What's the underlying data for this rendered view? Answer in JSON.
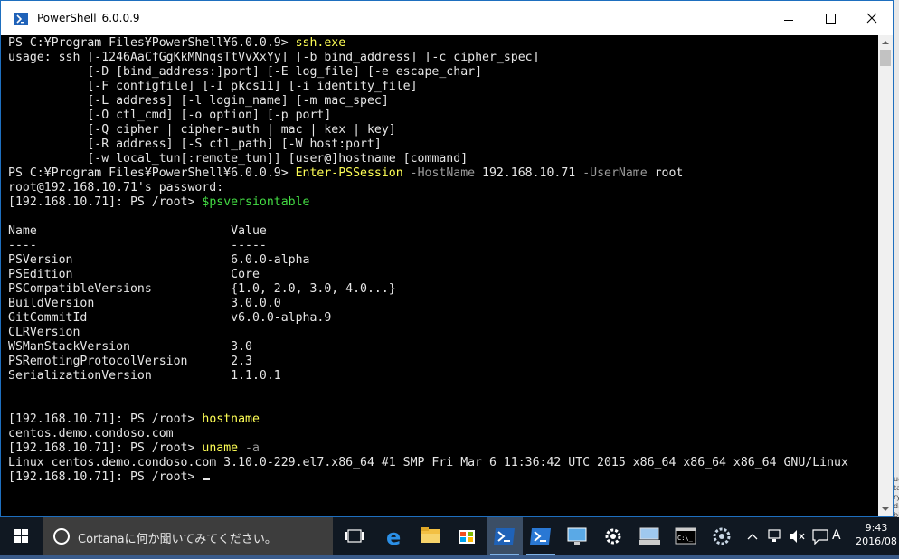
{
  "window": {
    "title": "PowerShell_6.0.0.9"
  },
  "console": {
    "lines": [
      [
        {
          "t": "PS C:¥Program Files¥PowerShell¥6.0.0.9> "
        },
        {
          "t": "ssh.exe",
          "c": "cmd"
        }
      ],
      [
        {
          "t": "usage: ssh [-1246AaCfGgKkMNnqsTtVvXxYy] [-b bind_address] [-c cipher_spec]"
        }
      ],
      [
        {
          "t": "           [-D [bind_address:]port] [-E log_file] [-e escape_char]"
        }
      ],
      [
        {
          "t": "           [-F configfile] [-I pkcs11] [-i identity_file]"
        }
      ],
      [
        {
          "t": "           [-L address] [-l login_name] [-m mac_spec]"
        }
      ],
      [
        {
          "t": "           [-O ctl_cmd] [-o option] [-p port]"
        }
      ],
      [
        {
          "t": "           [-Q cipher | cipher-auth | mac | kex | key]"
        }
      ],
      [
        {
          "t": "           [-R address] [-S ctl_path] [-W host:port]"
        }
      ],
      [
        {
          "t": "           [-w local_tun[:remote_tun]] [user@]hostname [command]"
        }
      ],
      [
        {
          "t": "PS C:¥Program Files¥PowerShell¥6.0.0.9> "
        },
        {
          "t": "Enter-PSSession",
          "c": "cmd"
        },
        {
          "t": " -HostName",
          "c": "param"
        },
        {
          "t": " 192.168.10.71"
        },
        {
          "t": " -UserName",
          "c": "param"
        },
        {
          "t": " root"
        }
      ],
      [
        {
          "t": "root@192.168.10.71's password:"
        }
      ],
      [
        {
          "t": "[192.168.10.71]: PS /root> "
        },
        {
          "t": "$psversiontable",
          "c": "var"
        }
      ],
      [
        {
          "t": ""
        }
      ],
      [
        {
          "t": "Name                           Value"
        }
      ],
      [
        {
          "t": "----                           -----"
        }
      ],
      [
        {
          "t": "PSVersion                      6.0.0-alpha"
        }
      ],
      [
        {
          "t": "PSEdition                      Core"
        }
      ],
      [
        {
          "t": "PSCompatibleVersions           {1.0, 2.0, 3.0, 4.0...}"
        }
      ],
      [
        {
          "t": "BuildVersion                   3.0.0.0"
        }
      ],
      [
        {
          "t": "GitCommitId                    v6.0.0-alpha.9"
        }
      ],
      [
        {
          "t": "CLRVersion"
        }
      ],
      [
        {
          "t": "WSManStackVersion              3.0"
        }
      ],
      [
        {
          "t": "PSRemotingProtocolVersion      2.3"
        }
      ],
      [
        {
          "t": "SerializationVersion           1.1.0.1"
        }
      ],
      [
        {
          "t": ""
        }
      ],
      [
        {
          "t": ""
        }
      ],
      [
        {
          "t": "[192.168.10.71]: PS /root> "
        },
        {
          "t": "hostname",
          "c": "cmd"
        }
      ],
      [
        {
          "t": "centos.demo.condoso.com"
        }
      ],
      [
        {
          "t": "[192.168.10.71]: PS /root> "
        },
        {
          "t": "uname",
          "c": "cmd"
        },
        {
          "t": " -a",
          "c": "param"
        }
      ],
      [
        {
          "t": "Linux centos.demo.condoso.com 3.10.0-229.el7.x86_64 #1 SMP Fri Mar 6 11:36:42 UTC 2015 x86_64 x86_64 x86_64 GNU/Linux"
        }
      ],
      [
        {
          "t": "[192.168.10.71]: PS /root> "
        },
        {
          "t": "",
          "c": "cursor"
        }
      ]
    ]
  },
  "taskbar": {
    "search_text": "Cortanaに何か聞いてみてください。",
    "ime": "A",
    "time": "9:43",
    "date": "2016/08"
  },
  "desktop": {
    "side_fragments": [
      "ua",
      "ta",
      "ry",
      "da",
      "bi"
    ]
  },
  "colors": {
    "accent": "#1e6fbf",
    "console_bg": "#000000",
    "command": "#ffff55",
    "parameter": "#9a9a9a",
    "variable": "#44dd44"
  }
}
